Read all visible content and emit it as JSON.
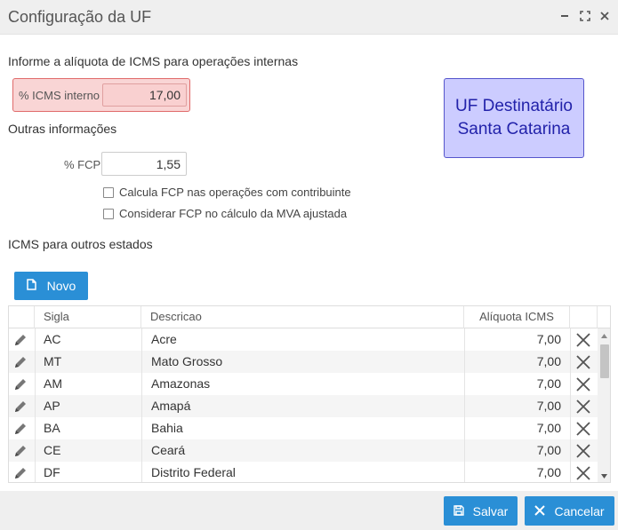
{
  "window": {
    "title": "Configuração da UF"
  },
  "section_internal": {
    "title": "Informe a alíquota de ICMS para operações internas",
    "icms_label": "% ICMS interno",
    "icms_value": "17,00"
  },
  "uf_box": {
    "line1": "UF Destinatário",
    "line2": "Santa Catarina"
  },
  "section_other": {
    "title": "Outras informações",
    "fcp_label": "% FCP",
    "fcp_value": "1,55",
    "check1_label": "Calcula FCP nas operações com contribuinte",
    "check2_label": "Considerar FCP no cálculo da MVA ajustada"
  },
  "section_states": {
    "title": "ICMS para outros estados",
    "novo_label": "Novo"
  },
  "grid": {
    "headers": {
      "sigla": "Sigla",
      "descricao": "Descricao",
      "aliquota": "Alíquota ICMS"
    },
    "rows": [
      {
        "sigla": "AC",
        "descricao": "Acre",
        "aliquota": "7,00"
      },
      {
        "sigla": "MT",
        "descricao": "Mato Grosso",
        "aliquota": "7,00"
      },
      {
        "sigla": "AM",
        "descricao": "Amazonas",
        "aliquota": "7,00"
      },
      {
        "sigla": "AP",
        "descricao": "Amapá",
        "aliquota": "7,00"
      },
      {
        "sigla": "BA",
        "descricao": "Bahia",
        "aliquota": "7,00"
      },
      {
        "sigla": "CE",
        "descricao": "Ceará",
        "aliquota": "7,00"
      },
      {
        "sigla": "DF",
        "descricao": "Distrito Federal",
        "aliquota": "7,00"
      }
    ]
  },
  "footer": {
    "save_label": "Salvar",
    "cancel_label": "Cancelar"
  },
  "colors": {
    "primary_button": "#2a8fd6",
    "uf_box_bg": "#ccccff",
    "uf_box_text": "#2222aa",
    "icms_highlight": "#f9d5d5"
  }
}
